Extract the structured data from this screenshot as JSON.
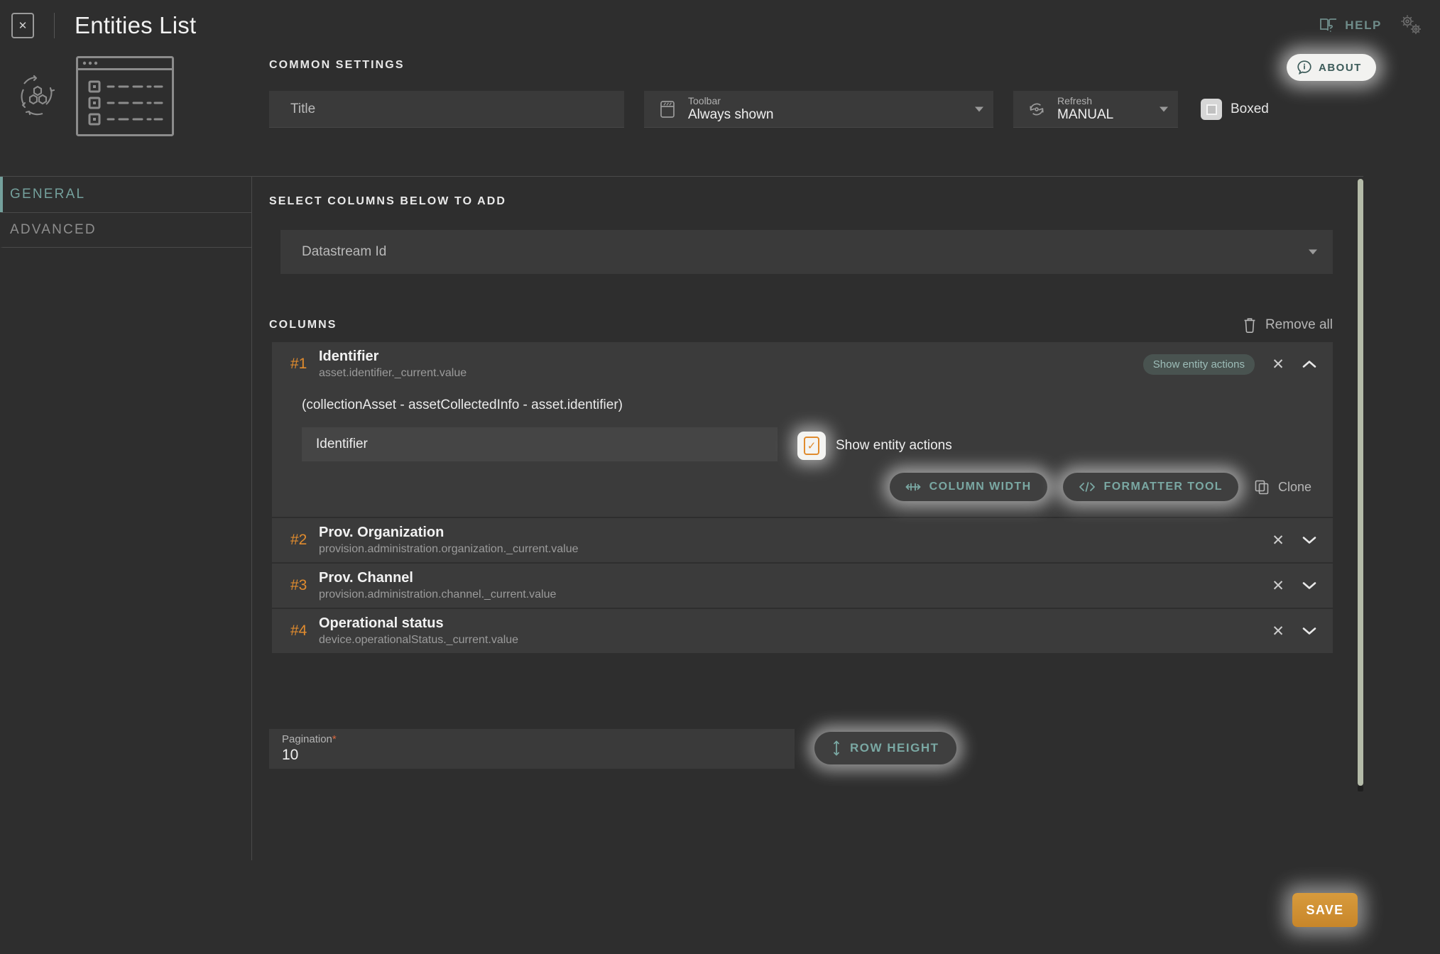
{
  "topbar": {
    "close_label": "✕",
    "title": "Entities List",
    "help_label": "HELP",
    "help_icon": "book-question-icon",
    "gears_icon": "gears-icon"
  },
  "about": {
    "label": "ABOUT",
    "icon": "info-circle-icon"
  },
  "common_settings": {
    "heading": "COMMON SETTINGS",
    "title_field": {
      "placeholder": "Title",
      "value": ""
    },
    "toolbar": {
      "label": "Toolbar",
      "value": "Always shown",
      "icon": "toolbar-icon"
    },
    "refresh": {
      "label": "Refresh",
      "value": "MANUAL",
      "icon": "refresh-icon"
    },
    "boxed": {
      "label": "Boxed",
      "checked": false
    }
  },
  "preview": {
    "entity_icon": "entity-hexagon-icon",
    "widget_icon": "list-widget-preview-icon"
  },
  "sidebar": {
    "tabs": [
      {
        "label": "GENERAL",
        "active": true
      },
      {
        "label": "ADVANCED",
        "active": false
      }
    ]
  },
  "main": {
    "select_columns_heading": "SELECT COLUMNS BELOW TO ADD",
    "datastream_select": {
      "placeholder": "Datastream Id",
      "value": ""
    },
    "columns_heading": "COLUMNS",
    "remove_all": {
      "label": "Remove all",
      "icon": "trash-icon"
    }
  },
  "columns": [
    {
      "num": "#1",
      "name": "Identifier",
      "path": "asset.identifier._current.value",
      "badge": "Show entity actions",
      "expanded": true,
      "expression": "(collectionAsset - assetCollectedInfo - asset.identifier)",
      "name_input_value": "Identifier",
      "show_entity_actions": {
        "label": "Show entity actions",
        "checked": true
      },
      "buttons": {
        "column_width": "COLUMN WIDTH",
        "formatter_tool": "FORMATTER TOOL",
        "clone": "Clone"
      }
    },
    {
      "num": "#2",
      "name": "Prov. Organization",
      "path": "provision.administration.organization._current.value",
      "expanded": false
    },
    {
      "num": "#3",
      "name": "Prov. Channel",
      "path": "provision.administration.channel._current.value",
      "expanded": false
    },
    {
      "num": "#4",
      "name": "Operational status",
      "path": "device.operationalStatus._current.value",
      "expanded": false
    }
  ],
  "pagination": {
    "label": "Pagination",
    "required_marker": "*",
    "value": "10"
  },
  "row_height": {
    "label": "ROW HEIGHT",
    "icon": "height-arrows-icon"
  },
  "save": {
    "label": "SAVE"
  },
  "colors": {
    "background": "#2e2e2e",
    "panel": "#3a3a3a",
    "card": "#3b3b3b",
    "accent_teal": "#74a09c",
    "accent_orange": "#e08b2e",
    "save_orange": "#d79b3d",
    "required_red": "#d9683f"
  }
}
